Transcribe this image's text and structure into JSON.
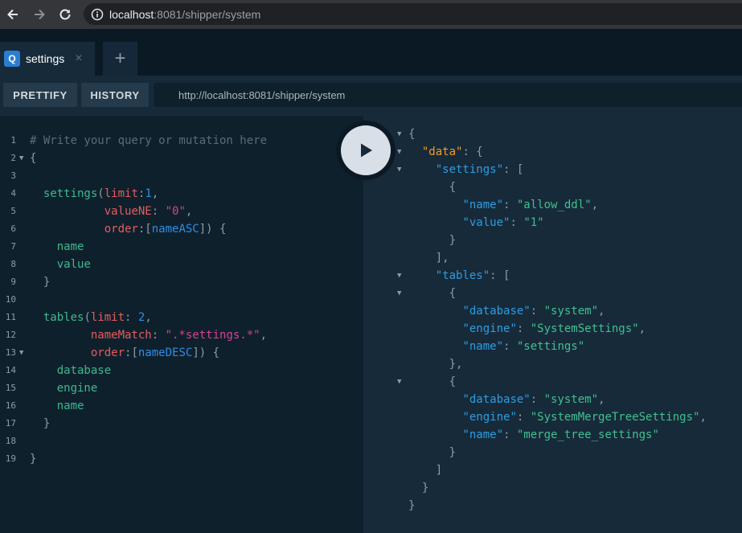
{
  "browser": {
    "url_host": "localhost",
    "url_rest": ":8081/shipper/system",
    "icons": [
      "back-arrow-icon",
      "forward-arrow-icon",
      "reload-icon",
      "info-icon"
    ]
  },
  "tabs": [
    {
      "badge": "Q",
      "label": "settings",
      "close": "×"
    }
  ],
  "tab_add": "+",
  "toolbar": {
    "prettify": "PRETTIFY",
    "history": "HISTORY",
    "endpoint": "http://localhost:8081/shipper/system"
  },
  "editor": {
    "lines": [
      {
        "n": "1",
        "fold": false,
        "tokens": [
          {
            "t": "# Write your query or mutation here",
            "c": "c-comment"
          }
        ]
      },
      {
        "n": "2",
        "fold": true,
        "tokens": [
          {
            "t": "{",
            "c": "c-punc"
          }
        ]
      },
      {
        "n": "3",
        "fold": false,
        "tokens": []
      },
      {
        "n": "4",
        "fold": false,
        "tokens": [
          {
            "t": "  "
          },
          {
            "t": "settings",
            "c": "c-field"
          },
          {
            "t": "(",
            "c": "c-punc"
          },
          {
            "t": "limit",
            "c": "c-arg"
          },
          {
            "t": ":",
            "c": "c-punc"
          },
          {
            "t": "1",
            "c": "c-num"
          },
          {
            "t": ",",
            "c": "c-punc"
          }
        ]
      },
      {
        "n": "5",
        "fold": false,
        "tokens": [
          {
            "t": "           "
          },
          {
            "t": "valueNE",
            "c": "c-arg"
          },
          {
            "t": ": ",
            "c": "c-punc"
          },
          {
            "t": "\"0\"",
            "c": "c-str"
          },
          {
            "t": ",",
            "c": "c-punc"
          }
        ]
      },
      {
        "n": "6",
        "fold": false,
        "tokens": [
          {
            "t": "           "
          },
          {
            "t": "order",
            "c": "c-arg"
          },
          {
            "t": ":[",
            "c": "c-punc"
          },
          {
            "t": "nameASC",
            "c": "c-enum"
          },
          {
            "t": "]) {",
            "c": "c-punc"
          }
        ]
      },
      {
        "n": "7",
        "fold": false,
        "tokens": [
          {
            "t": "    "
          },
          {
            "t": "name",
            "c": "c-field"
          }
        ]
      },
      {
        "n": "8",
        "fold": false,
        "tokens": [
          {
            "t": "    "
          },
          {
            "t": "value",
            "c": "c-field"
          }
        ]
      },
      {
        "n": "9",
        "fold": false,
        "tokens": [
          {
            "t": "  "
          },
          {
            "t": "}",
            "c": "c-punc"
          }
        ]
      },
      {
        "n": "10",
        "fold": false,
        "tokens": []
      },
      {
        "n": "11",
        "fold": false,
        "tokens": [
          {
            "t": "  "
          },
          {
            "t": "tables",
            "c": "c-field"
          },
          {
            "t": "(",
            "c": "c-punc"
          },
          {
            "t": "limit",
            "c": "c-arg"
          },
          {
            "t": ": ",
            "c": "c-punc"
          },
          {
            "t": "2",
            "c": "c-num"
          },
          {
            "t": ",",
            "c": "c-punc"
          }
        ]
      },
      {
        "n": "12",
        "fold": false,
        "tokens": [
          {
            "t": "         "
          },
          {
            "t": "nameMatch",
            "c": "c-arg"
          },
          {
            "t": ": ",
            "c": "c-punc"
          },
          {
            "t": "\".*settings.*\"",
            "c": "c-str"
          },
          {
            "t": ",",
            "c": "c-punc"
          }
        ]
      },
      {
        "n": "13",
        "fold": true,
        "tokens": [
          {
            "t": "         "
          },
          {
            "t": "order",
            "c": "c-arg"
          },
          {
            "t": ":[",
            "c": "c-punc"
          },
          {
            "t": "nameDESC",
            "c": "c-enum"
          },
          {
            "t": "]) {",
            "c": "c-punc"
          }
        ]
      },
      {
        "n": "14",
        "fold": false,
        "tokens": [
          {
            "t": "    "
          },
          {
            "t": "database",
            "c": "c-field"
          }
        ]
      },
      {
        "n": "15",
        "fold": false,
        "tokens": [
          {
            "t": "    "
          },
          {
            "t": "engine",
            "c": "c-field"
          }
        ]
      },
      {
        "n": "16",
        "fold": false,
        "tokens": [
          {
            "t": "    "
          },
          {
            "t": "name",
            "c": "c-field"
          }
        ]
      },
      {
        "n": "17",
        "fold": false,
        "tokens": [
          {
            "t": "  "
          },
          {
            "t": "}",
            "c": "c-punc"
          }
        ]
      },
      {
        "n": "18",
        "fold": false,
        "tokens": []
      },
      {
        "n": "19",
        "fold": false,
        "tokens": [
          {
            "t": "}",
            "c": "c-punc"
          }
        ]
      }
    ]
  },
  "result": {
    "lines": [
      {
        "fold": true,
        "tokens": [
          {
            "t": "{",
            "c": "c-punc"
          }
        ]
      },
      {
        "fold": true,
        "tokens": [
          {
            "t": "  "
          },
          {
            "t": "\"data\"",
            "c": "r-data"
          },
          {
            "t": ": {",
            "c": "c-punc"
          }
        ]
      },
      {
        "fold": true,
        "tokens": [
          {
            "t": "    "
          },
          {
            "t": "\"settings\"",
            "c": "r-key"
          },
          {
            "t": ": [",
            "c": "c-punc"
          }
        ]
      },
      {
        "fold": false,
        "tokens": [
          {
            "t": "      "
          },
          {
            "t": "{",
            "c": "c-punc"
          }
        ]
      },
      {
        "fold": false,
        "tokens": [
          {
            "t": "        "
          },
          {
            "t": "\"name\"",
            "c": "r-key"
          },
          {
            "t": ": ",
            "c": "c-punc"
          },
          {
            "t": "\"allow_ddl\"",
            "c": "r-str"
          },
          {
            "t": ",",
            "c": "c-punc"
          }
        ]
      },
      {
        "fold": false,
        "tokens": [
          {
            "t": "        "
          },
          {
            "t": "\"value\"",
            "c": "r-key"
          },
          {
            "t": ": ",
            "c": "c-punc"
          },
          {
            "t": "\"1\"",
            "c": "r-str"
          }
        ]
      },
      {
        "fold": false,
        "tokens": [
          {
            "t": "      "
          },
          {
            "t": "}",
            "c": "c-punc"
          }
        ]
      },
      {
        "fold": false,
        "tokens": [
          {
            "t": "    "
          },
          {
            "t": "],",
            "c": "c-punc"
          }
        ]
      },
      {
        "fold": true,
        "tokens": [
          {
            "t": "    "
          },
          {
            "t": "\"tables\"",
            "c": "r-key"
          },
          {
            "t": ": [",
            "c": "c-punc"
          }
        ]
      },
      {
        "fold": true,
        "tokens": [
          {
            "t": "      "
          },
          {
            "t": "{",
            "c": "c-punc"
          }
        ]
      },
      {
        "fold": false,
        "tokens": [
          {
            "t": "        "
          },
          {
            "t": "\"database\"",
            "c": "r-key"
          },
          {
            "t": ": ",
            "c": "c-punc"
          },
          {
            "t": "\"system\"",
            "c": "r-str"
          },
          {
            "t": ",",
            "c": "c-punc"
          }
        ]
      },
      {
        "fold": false,
        "tokens": [
          {
            "t": "        "
          },
          {
            "t": "\"engine\"",
            "c": "r-key"
          },
          {
            "t": ": ",
            "c": "c-punc"
          },
          {
            "t": "\"SystemSettings\"",
            "c": "r-str"
          },
          {
            "t": ",",
            "c": "c-punc"
          }
        ]
      },
      {
        "fold": false,
        "tokens": [
          {
            "t": "        "
          },
          {
            "t": "\"name\"",
            "c": "r-key"
          },
          {
            "t": ": ",
            "c": "c-punc"
          },
          {
            "t": "\"settings\"",
            "c": "r-str"
          }
        ]
      },
      {
        "fold": false,
        "tokens": [
          {
            "t": "      "
          },
          {
            "t": "},",
            "c": "c-punc"
          }
        ]
      },
      {
        "fold": true,
        "tokens": [
          {
            "t": "      "
          },
          {
            "t": "{",
            "c": "c-punc"
          }
        ]
      },
      {
        "fold": false,
        "tokens": [
          {
            "t": "        "
          },
          {
            "t": "\"database\"",
            "c": "r-key"
          },
          {
            "t": ": ",
            "c": "c-punc"
          },
          {
            "t": "\"system\"",
            "c": "r-str"
          },
          {
            "t": ",",
            "c": "c-punc"
          }
        ]
      },
      {
        "fold": false,
        "tokens": [
          {
            "t": "        "
          },
          {
            "t": "\"engine\"",
            "c": "r-key"
          },
          {
            "t": ": ",
            "c": "c-punc"
          },
          {
            "t": "\"SystemMergeTreeSettings\"",
            "c": "r-str"
          },
          {
            "t": ",",
            "c": "c-punc"
          }
        ]
      },
      {
        "fold": false,
        "tokens": [
          {
            "t": "        "
          },
          {
            "t": "\"name\"",
            "c": "r-key"
          },
          {
            "t": ": ",
            "c": "c-punc"
          },
          {
            "t": "\"merge_tree_settings\"",
            "c": "r-str"
          }
        ]
      },
      {
        "fold": false,
        "tokens": [
          {
            "t": "      "
          },
          {
            "t": "}",
            "c": "c-punc"
          }
        ]
      },
      {
        "fold": false,
        "tokens": [
          {
            "t": "    "
          },
          {
            "t": "]",
            "c": "c-punc"
          }
        ]
      },
      {
        "fold": false,
        "tokens": [
          {
            "t": "  "
          },
          {
            "t": "}",
            "c": "c-punc"
          }
        ]
      },
      {
        "fold": false,
        "tokens": [
          {
            "t": "}",
            "c": "c-punc"
          }
        ]
      }
    ]
  }
}
